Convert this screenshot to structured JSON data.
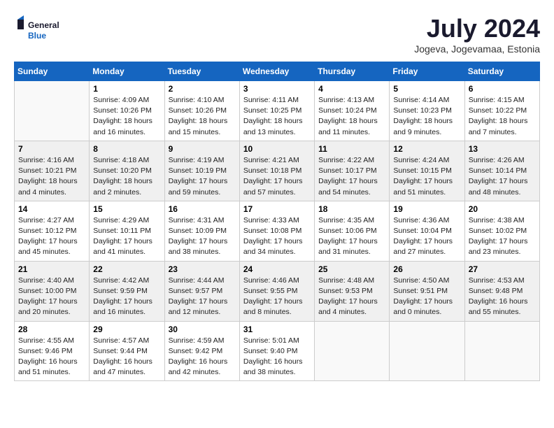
{
  "header": {
    "logo_line1": "General",
    "logo_line2": "Blue",
    "month": "July 2024",
    "location": "Jogeva, Jogevamaa, Estonia"
  },
  "weekdays": [
    "Sunday",
    "Monday",
    "Tuesday",
    "Wednesday",
    "Thursday",
    "Friday",
    "Saturday"
  ],
  "weeks": [
    [
      {
        "day": "",
        "info": ""
      },
      {
        "day": "1",
        "info": "Sunrise: 4:09 AM\nSunset: 10:26 PM\nDaylight: 18 hours\nand 16 minutes."
      },
      {
        "day": "2",
        "info": "Sunrise: 4:10 AM\nSunset: 10:26 PM\nDaylight: 18 hours\nand 15 minutes."
      },
      {
        "day": "3",
        "info": "Sunrise: 4:11 AM\nSunset: 10:25 PM\nDaylight: 18 hours\nand 13 minutes."
      },
      {
        "day": "4",
        "info": "Sunrise: 4:13 AM\nSunset: 10:24 PM\nDaylight: 18 hours\nand 11 minutes."
      },
      {
        "day": "5",
        "info": "Sunrise: 4:14 AM\nSunset: 10:23 PM\nDaylight: 18 hours\nand 9 minutes."
      },
      {
        "day": "6",
        "info": "Sunrise: 4:15 AM\nSunset: 10:22 PM\nDaylight: 18 hours\nand 7 minutes."
      }
    ],
    [
      {
        "day": "7",
        "info": "Sunrise: 4:16 AM\nSunset: 10:21 PM\nDaylight: 18 hours\nand 4 minutes."
      },
      {
        "day": "8",
        "info": "Sunrise: 4:18 AM\nSunset: 10:20 PM\nDaylight: 18 hours\nand 2 minutes."
      },
      {
        "day": "9",
        "info": "Sunrise: 4:19 AM\nSunset: 10:19 PM\nDaylight: 17 hours\nand 59 minutes."
      },
      {
        "day": "10",
        "info": "Sunrise: 4:21 AM\nSunset: 10:18 PM\nDaylight: 17 hours\nand 57 minutes."
      },
      {
        "day": "11",
        "info": "Sunrise: 4:22 AM\nSunset: 10:17 PM\nDaylight: 17 hours\nand 54 minutes."
      },
      {
        "day": "12",
        "info": "Sunrise: 4:24 AM\nSunset: 10:15 PM\nDaylight: 17 hours\nand 51 minutes."
      },
      {
        "day": "13",
        "info": "Sunrise: 4:26 AM\nSunset: 10:14 PM\nDaylight: 17 hours\nand 48 minutes."
      }
    ],
    [
      {
        "day": "14",
        "info": "Sunrise: 4:27 AM\nSunset: 10:12 PM\nDaylight: 17 hours\nand 45 minutes."
      },
      {
        "day": "15",
        "info": "Sunrise: 4:29 AM\nSunset: 10:11 PM\nDaylight: 17 hours\nand 41 minutes."
      },
      {
        "day": "16",
        "info": "Sunrise: 4:31 AM\nSunset: 10:09 PM\nDaylight: 17 hours\nand 38 minutes."
      },
      {
        "day": "17",
        "info": "Sunrise: 4:33 AM\nSunset: 10:08 PM\nDaylight: 17 hours\nand 34 minutes."
      },
      {
        "day": "18",
        "info": "Sunrise: 4:35 AM\nSunset: 10:06 PM\nDaylight: 17 hours\nand 31 minutes."
      },
      {
        "day": "19",
        "info": "Sunrise: 4:36 AM\nSunset: 10:04 PM\nDaylight: 17 hours\nand 27 minutes."
      },
      {
        "day": "20",
        "info": "Sunrise: 4:38 AM\nSunset: 10:02 PM\nDaylight: 17 hours\nand 23 minutes."
      }
    ],
    [
      {
        "day": "21",
        "info": "Sunrise: 4:40 AM\nSunset: 10:00 PM\nDaylight: 17 hours\nand 20 minutes."
      },
      {
        "day": "22",
        "info": "Sunrise: 4:42 AM\nSunset: 9:59 PM\nDaylight: 17 hours\nand 16 minutes."
      },
      {
        "day": "23",
        "info": "Sunrise: 4:44 AM\nSunset: 9:57 PM\nDaylight: 17 hours\nand 12 minutes."
      },
      {
        "day": "24",
        "info": "Sunrise: 4:46 AM\nSunset: 9:55 PM\nDaylight: 17 hours\nand 8 minutes."
      },
      {
        "day": "25",
        "info": "Sunrise: 4:48 AM\nSunset: 9:53 PM\nDaylight: 17 hours\nand 4 minutes."
      },
      {
        "day": "26",
        "info": "Sunrise: 4:50 AM\nSunset: 9:51 PM\nDaylight: 17 hours\nand 0 minutes."
      },
      {
        "day": "27",
        "info": "Sunrise: 4:53 AM\nSunset: 9:48 PM\nDaylight: 16 hours\nand 55 minutes."
      }
    ],
    [
      {
        "day": "28",
        "info": "Sunrise: 4:55 AM\nSunset: 9:46 PM\nDaylight: 16 hours\nand 51 minutes."
      },
      {
        "day": "29",
        "info": "Sunrise: 4:57 AM\nSunset: 9:44 PM\nDaylight: 16 hours\nand 47 minutes."
      },
      {
        "day": "30",
        "info": "Sunrise: 4:59 AM\nSunset: 9:42 PM\nDaylight: 16 hours\nand 42 minutes."
      },
      {
        "day": "31",
        "info": "Sunrise: 5:01 AM\nSunset: 9:40 PM\nDaylight: 16 hours\nand 38 minutes."
      },
      {
        "day": "",
        "info": ""
      },
      {
        "day": "",
        "info": ""
      },
      {
        "day": "",
        "info": ""
      }
    ]
  ]
}
